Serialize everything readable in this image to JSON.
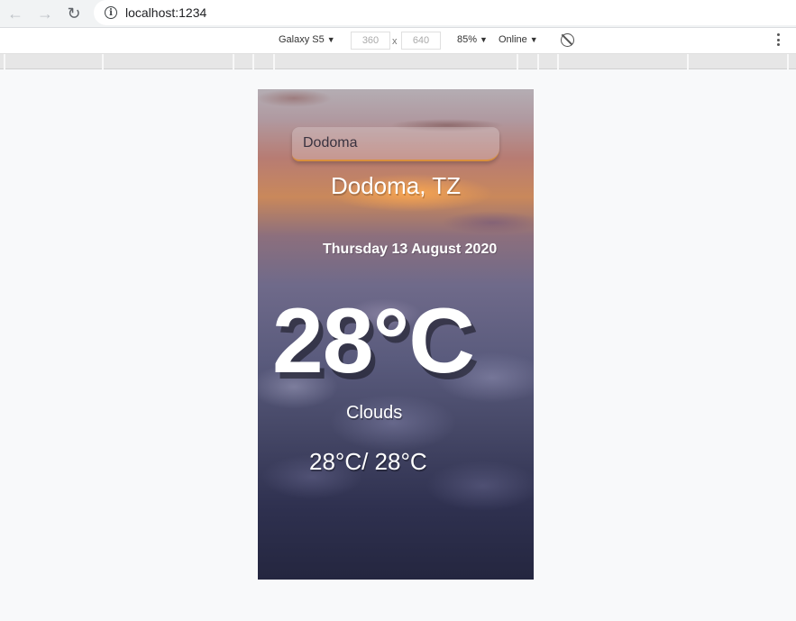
{
  "browser": {
    "url": "localhost:1234"
  },
  "device_toolbar": {
    "device": "Galaxy S5",
    "width": "360",
    "height": "640",
    "separator": "x",
    "zoom": "85%",
    "network": "Online"
  },
  "app": {
    "search_value": "Dodoma",
    "location": "Dodoma, TZ",
    "date": "Thursday 13 August 2020",
    "temperature": "28°C",
    "weather": "Clouds",
    "hi_low": "28°C/ 28°C"
  },
  "colors": {
    "search_underline": "#d98f3c",
    "text": "#ffffff"
  }
}
